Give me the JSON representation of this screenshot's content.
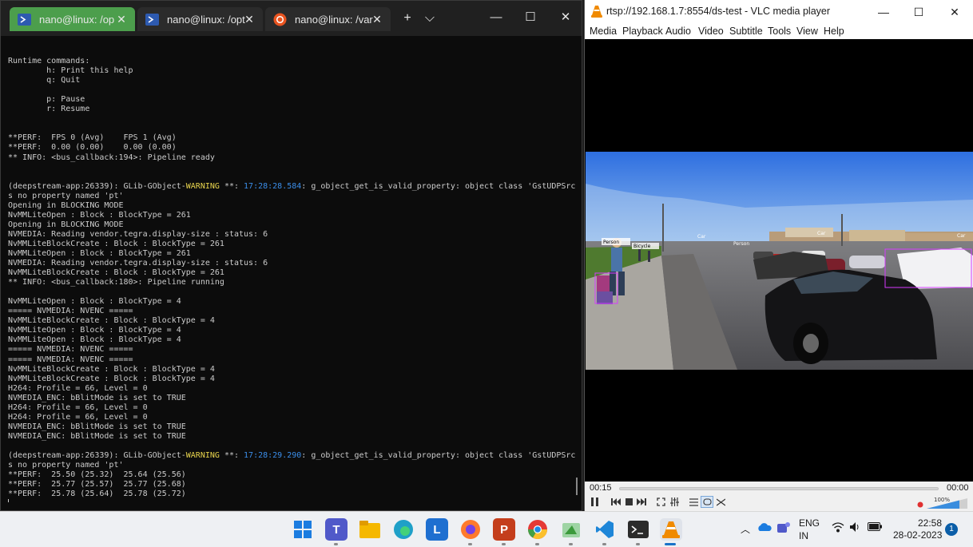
{
  "terminal": {
    "tabs": [
      {
        "label": "nano@linux: /op",
        "icon": "powershell-icon",
        "active": true
      },
      {
        "label": "nano@linux: /opt",
        "icon": "powershell-icon",
        "active": false
      },
      {
        "label": "nano@linux: /var",
        "icon": "ubuntu-icon",
        "active": false
      }
    ],
    "new_tab": "+",
    "dropdown": "⌵",
    "lines": [
      "",
      "Runtime commands:",
      "        h: Print this help",
      "        q: Quit",
      "",
      "        p: Pause",
      "        r: Resume",
      "",
      "",
      "**PERF:  FPS 0 (Avg)    FPS 1 (Avg)",
      "**PERF:  0.00 (0.00)    0.00 (0.00)",
      "** INFO: <bus_callback:194>: Pipeline ready",
      "",
      "",
      {
        "pre": "(deepstream-app:26339): GLib-GObject-",
        "warn": "WARNING",
        "mid": " **: ",
        "ts": "17:28:28.584",
        "post": ": g_object_get_is_valid_property: object class 'GstUDPSrc' ha"
      },
      "s no property named 'pt'",
      "Opening in BLOCKING MODE",
      "NvMMLiteOpen : Block : BlockType = 261",
      "Opening in BLOCKING MODE",
      "NVMEDIA: Reading vendor.tegra.display-size : status: 6",
      "NvMMLiteBlockCreate : Block : BlockType = 261",
      "NvMMLiteOpen : Block : BlockType = 261",
      "NVMEDIA: Reading vendor.tegra.display-size : status: 6",
      "NvMMLiteBlockCreate : Block : BlockType = 261",
      "** INFO: <bus_callback:180>: Pipeline running",
      "",
      "NvMMLiteOpen : Block : BlockType = 4",
      "===== NVMEDIA: NVENC =====",
      "NvMMLiteBlockCreate : Block : BlockType = 4",
      "NvMMLiteOpen : Block : BlockType = 4",
      "NvMMLiteOpen : Block : BlockType = 4",
      "===== NVMEDIA: NVENC =====",
      "===== NVMEDIA: NVENC =====",
      "NvMMLiteBlockCreate : Block : BlockType = 4",
      "NvMMLiteBlockCreate : Block : BlockType = 4",
      "H264: Profile = 66, Level = 0",
      "NVMEDIA_ENC: bBlitMode is set to TRUE",
      "H264: Profile = 66, Level = 0",
      "H264: Profile = 66, Level = 0",
      "NVMEDIA_ENC: bBlitMode is set to TRUE",
      "NVMEDIA_ENC: bBlitMode is set to TRUE",
      "",
      {
        "pre": "(deepstream-app:26339): GLib-GObject-",
        "warn": "WARNING",
        "mid": " **: ",
        "ts": "17:28:29.290",
        "post": ": g_object_get_is_valid_property: object class 'GstUDPSrc' ha"
      },
      "s no property named 'pt'",
      "**PERF:  25.50 (25.32)  25.64 (25.56)",
      "**PERF:  25.77 (25.57)  25.77 (25.68)",
      "**PERF:  25.78 (25.64)  25.78 (25.72)"
    ]
  },
  "vlc": {
    "title": "rtsp://192.168.1.7:8554/ds-test - VLC media player",
    "menu": [
      "Media",
      "Playback",
      "Audio",
      "Video",
      "Subtitle",
      "Tools",
      "View",
      "Help"
    ],
    "elapsed": "00:15",
    "remaining": "00:00",
    "volume": "100%",
    "detections": [
      "Person",
      "Bicycle",
      "Car",
      "Car",
      "Car",
      "Person"
    ]
  },
  "taskbar": {
    "apps": [
      "windows-start-icon",
      "teams-icon",
      "file-explorer-icon",
      "edge-icon",
      "l-app-icon",
      "firefox-icon",
      "powerpoint-icon",
      "chrome-icon",
      "paint-icon",
      "vscode-icon",
      "terminal-icon",
      "vlc-icon"
    ],
    "language_1": "ENG",
    "language_2": "IN",
    "time": "22:58",
    "date": "28-02-2023",
    "notifications": "1"
  },
  "colors": {
    "terminal_bg": "#0c0c0c",
    "active_tab": "#4c9e4c",
    "warning": "#e8d44d",
    "timestamp": "#3b8eea",
    "vlc_orange": "#f08a00"
  }
}
